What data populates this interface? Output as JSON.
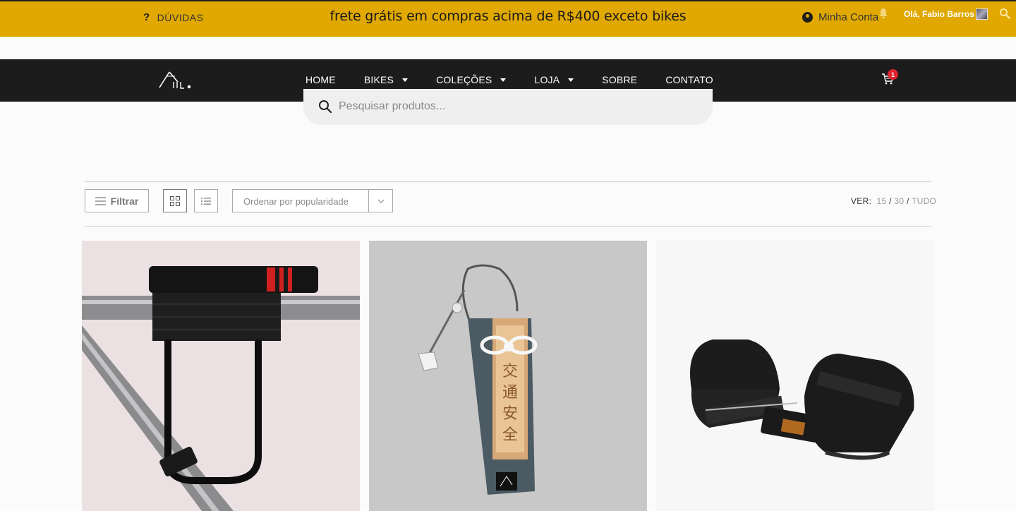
{
  "topbar": {
    "help_label": "DÚVIDAS",
    "promo_text": "frete grátis em compras acima de R$400 exceto bikes",
    "account_label": "Minha Conta",
    "greeting": "Olá, Fabio Barros"
  },
  "nav": {
    "items": [
      {
        "label": "HOME",
        "has_dropdown": false
      },
      {
        "label": "BIKES",
        "has_dropdown": true
      },
      {
        "label": "COLEÇÕES",
        "has_dropdown": true
      },
      {
        "label": "LOJA",
        "has_dropdown": true
      },
      {
        "label": "SOBRE",
        "has_dropdown": false
      },
      {
        "label": "CONTATO",
        "has_dropdown": false
      }
    ],
    "cart_count": "1"
  },
  "search": {
    "placeholder": "Pesquisar produtos..."
  },
  "toolbar": {
    "filter_label": "Filtrar",
    "sort_selected": "Ordenar por popularidade",
    "ver_label": "VER:",
    "ver_options": [
      "15",
      "30",
      "TUDO"
    ]
  },
  "colors": {
    "topbar_bg": "#e0a800",
    "navbar_bg": "#1c1c1c",
    "cart_badge": "#e0242f"
  },
  "icons": [
    "question-icon",
    "user-circle-icon",
    "bell-icon",
    "search-icon",
    "cart-icon",
    "chevron-down-icon",
    "menu-icon",
    "grid-view-icon",
    "list-view-icon"
  ]
}
